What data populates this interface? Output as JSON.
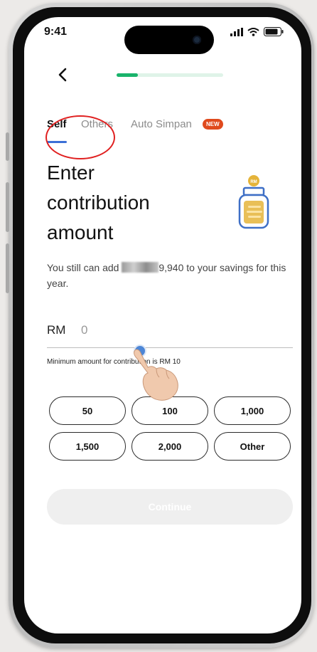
{
  "status_bar": {
    "time": "9:41"
  },
  "progress": {
    "fraction": 0.2
  },
  "tabs": [
    {
      "label": "Self",
      "active": true
    },
    {
      "label": "Others",
      "active": false
    },
    {
      "label": "Auto Simpan",
      "active": false,
      "badge": "NEW"
    }
  ],
  "page": {
    "heading": "Enter\ncontribution\namount",
    "jar_label": "RM",
    "info_before": "You still can add",
    "info_after": "9,940 to your savings for this year."
  },
  "amount_input": {
    "currency": "RM",
    "value": "0",
    "hint": "Minimum amount for contribution is RM 10"
  },
  "quick_amounts": [
    "50",
    "100",
    "1,000",
    "1,500",
    "2,000",
    "Other"
  ],
  "continue_label": "Continue",
  "colors": {
    "accent_green": "#19b36b",
    "tab_underline": "#3b6fd6",
    "new_badge": "#e04a1d",
    "annotation_red": "#e02020",
    "jar_gold": "#e5b43a",
    "jar_blue": "#3e6fc6"
  }
}
